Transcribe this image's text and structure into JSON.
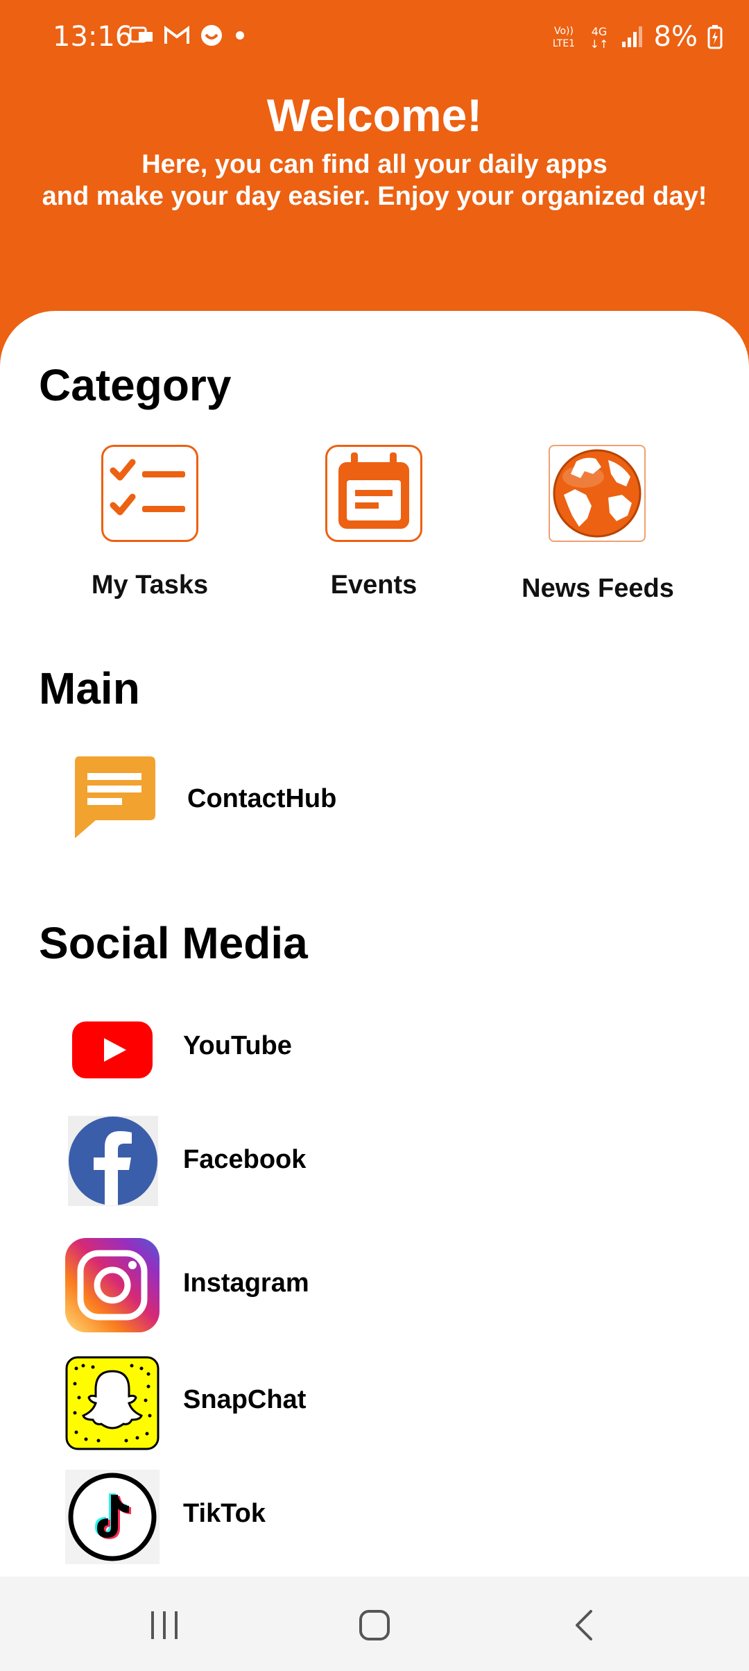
{
  "status_bar": {
    "time": "13:16",
    "battery": "8%",
    "network": "4G"
  },
  "header": {
    "title": "Welcome!",
    "subtitle_line1": "Here, you can find all your daily apps",
    "subtitle_line2": "and make your day easier. Enjoy your organized day!",
    "background_color": "#EC6112"
  },
  "category": {
    "title": "Category",
    "items": [
      {
        "label": "My Tasks",
        "icon": "checklist-icon"
      },
      {
        "label": "Events",
        "icon": "calendar-icon"
      },
      {
        "label": "News Feeds",
        "icon": "globe-icon"
      }
    ]
  },
  "main": {
    "title": "Main",
    "items": [
      {
        "label": "ContactHub",
        "icon": "chat-bubble-icon"
      }
    ]
  },
  "social": {
    "title": "Social Media",
    "items": [
      {
        "label": "YouTube",
        "icon": "youtube-icon"
      },
      {
        "label": "Facebook",
        "icon": "facebook-icon"
      },
      {
        "label": "Instagram",
        "icon": "instagram-icon"
      },
      {
        "label": "SnapChat",
        "icon": "snapchat-icon"
      },
      {
        "label": "TikTok",
        "icon": "tiktok-icon"
      }
    ]
  }
}
